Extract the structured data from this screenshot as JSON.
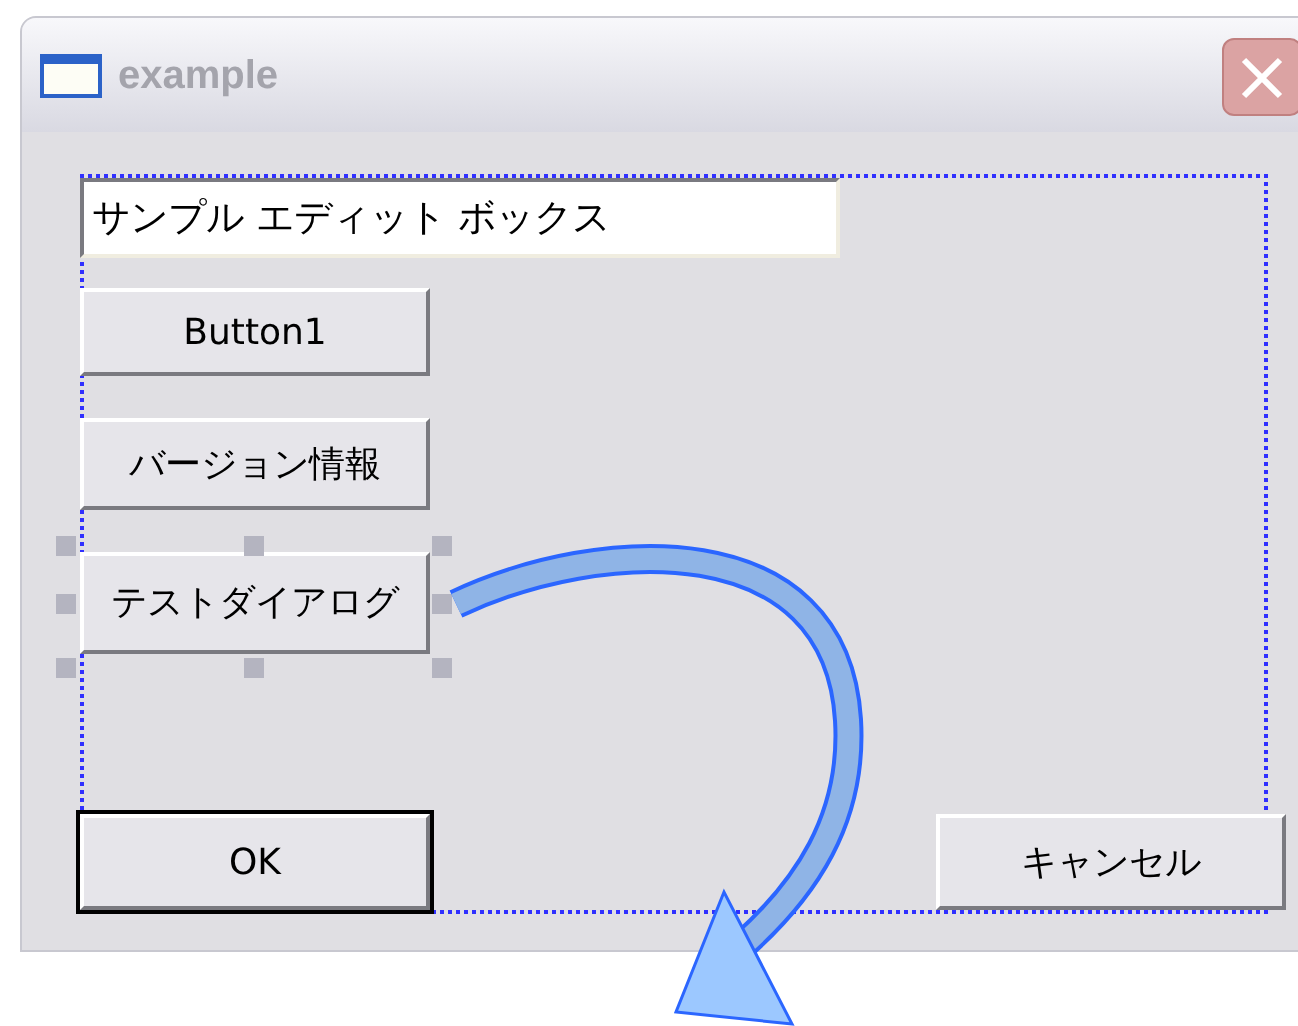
{
  "window": {
    "title": "example"
  },
  "edit_box": {
    "value": "サンプル エディット ボックス"
  },
  "buttons": [
    {
      "label": "Button1",
      "selected": false
    },
    {
      "label": "バージョン情報",
      "selected": false
    },
    {
      "label": "テストダイアログ",
      "selected": true
    }
  ],
  "footer_buttons": [
    {
      "label": "OK",
      "default": true
    },
    {
      "label": "キャンセル",
      "default": false
    }
  ]
}
